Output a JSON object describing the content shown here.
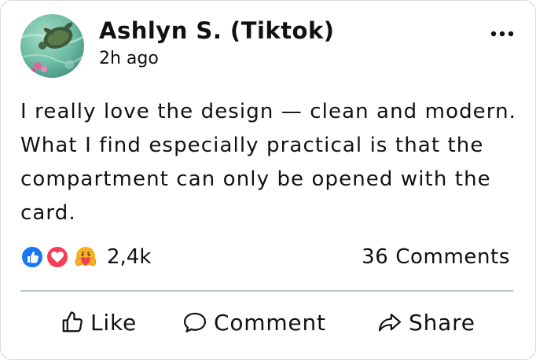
{
  "post": {
    "author": "Ashlyn S. (Tiktok)",
    "time": "2h ago",
    "text": "I really love the design — clean and modern. What I find especially practical is that the compartment can only be opened with the card.",
    "more_icon": "more-horizontal-icon"
  },
  "reactions": {
    "icons": [
      "like-icon",
      "love-icon",
      "care-icon"
    ],
    "count": "2,4k",
    "comments": "36 Comments"
  },
  "actions": {
    "like": "Like",
    "comment": "Comment",
    "share": "Share"
  },
  "colors": {
    "like_blue": "#1877f2",
    "love_red": "#f33e58",
    "care_yellow": "#f7b125",
    "divider": "#b8c0cc"
  }
}
